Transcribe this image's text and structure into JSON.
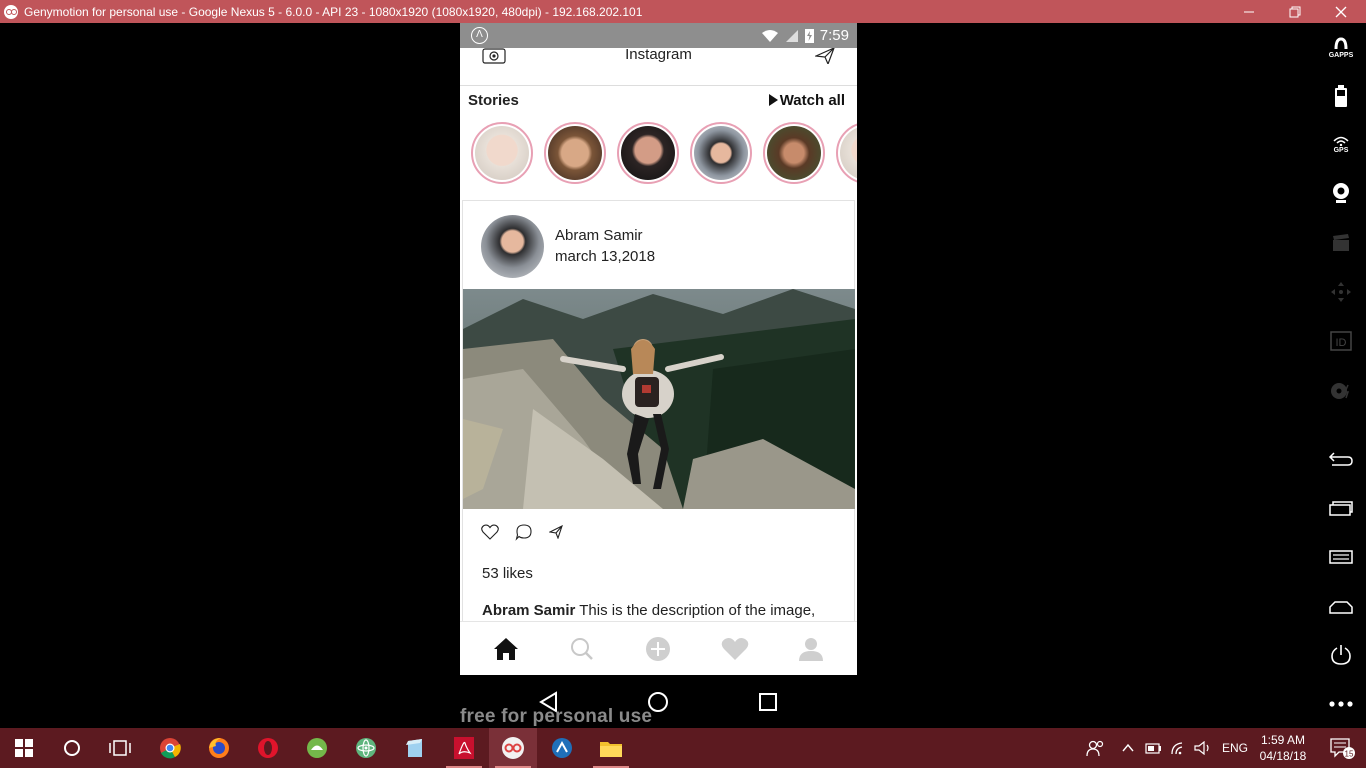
{
  "window": {
    "title": "Genymotion for personal use - Google Nexus 5 - 6.0.0 - API 23 - 1080x1920 (1080x1920, 480dpi) - 192.168.202.101",
    "accent": "#c0555a"
  },
  "statusbar": {
    "time": "7:59",
    "notif_letter": "Λ"
  },
  "app": {
    "header_title": "Instagram",
    "stories_label": "Stories",
    "watch_all": "Watch all",
    "stories": [
      {
        "name": "story-1",
        "color": "#d9c9bd"
      },
      {
        "name": "story-2",
        "color": "#b58a6a"
      },
      {
        "name": "story-3",
        "color": "#3a3232"
      },
      {
        "name": "story-4",
        "color": "#8a8f96"
      },
      {
        "name": "story-5",
        "color": "#5a4030"
      },
      {
        "name": "story-6",
        "color": "#d8c8b8"
      }
    ],
    "post": {
      "username": "Abram Samir",
      "date": "march 13,2018",
      "likes": "53 likes",
      "desc_user": "Abram Samir",
      "desc_text": " This is the description of the image,"
    },
    "tabs": [
      "home",
      "search",
      "add",
      "activity",
      "profile"
    ]
  },
  "watermark": "free for personal use",
  "taskbar": {
    "time": "1:59 AM",
    "date": "04/18/18",
    "lang": "ENG",
    "notif_count": "15"
  },
  "gm_tools": [
    {
      "name": "gapps-tool",
      "cap": "GAPPS"
    },
    {
      "name": "battery-tool",
      "cap": ""
    },
    {
      "name": "gps-tool",
      "cap": "GPS"
    },
    {
      "name": "webcam-tool",
      "cap": ""
    },
    {
      "name": "screencast-tool",
      "cap": ""
    },
    {
      "name": "remote-control-tool",
      "cap": ""
    },
    {
      "name": "identifiers-tool",
      "cap": "ID"
    },
    {
      "name": "disk-io-tool",
      "cap": ""
    }
  ]
}
